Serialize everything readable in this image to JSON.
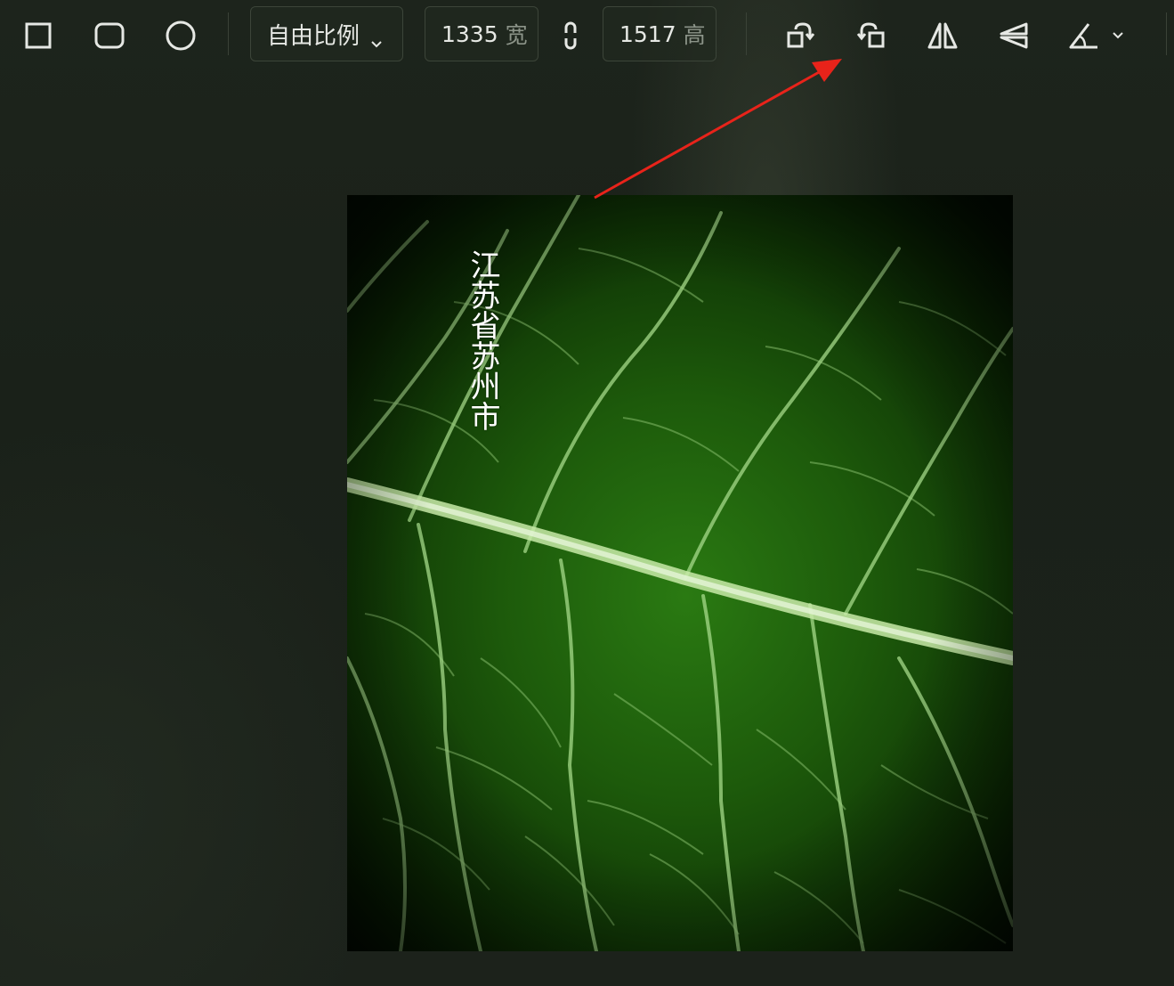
{
  "toolbar": {
    "shapes": [
      {
        "icon": "square-crop-icon"
      },
      {
        "icon": "rounded-square-crop-icon"
      },
      {
        "icon": "circle-crop-icon"
      }
    ],
    "aspect_ratio": {
      "selected": "自由比例",
      "icon": "chevron-down-icon"
    },
    "width": {
      "value": "1335",
      "unit": "宽"
    },
    "link_icon": "chain-link-icon",
    "height": {
      "value": "1517",
      "unit": "高"
    },
    "actions": [
      {
        "icon": "rotate-left-icon"
      },
      {
        "icon": "rotate-right-icon"
      },
      {
        "icon": "flip-horizontal-icon"
      },
      {
        "icon": "flip-vertical-icon"
      },
      {
        "icon": "angle-icon"
      }
    ]
  },
  "canvas": {
    "overlay_text": "江苏省苏州市"
  },
  "colors": {
    "background": "#1c231b",
    "annotation_arrow": "#e8231a",
    "toolbar_icon": "#e6e8e4",
    "unit_text": "#8c9489"
  }
}
